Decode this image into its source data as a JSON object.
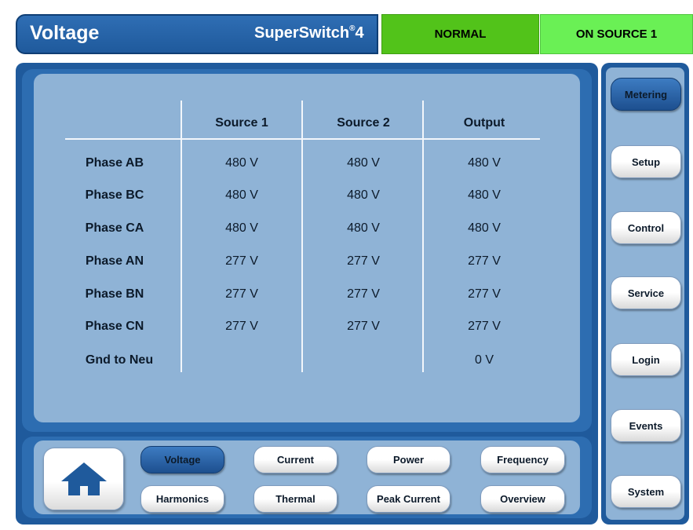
{
  "header": {
    "title": "Voltage",
    "product": "SuperSwitch",
    "product_sup": "®",
    "product_version": "4",
    "status_mode": "NORMAL",
    "status_source": "ON SOURCE 1"
  },
  "table": {
    "columns": [
      "Source 1",
      "Source 2",
      "Output"
    ],
    "rows": [
      {
        "label": "Phase AB",
        "values": [
          "480 V",
          "480 V",
          "480 V"
        ]
      },
      {
        "label": "Phase BC",
        "values": [
          "480 V",
          "480 V",
          "480 V"
        ]
      },
      {
        "label": "Phase CA",
        "values": [
          "480 V",
          "480 V",
          "480 V"
        ]
      },
      {
        "label": "Phase AN",
        "values": [
          "277 V",
          "277 V",
          "277 V"
        ]
      },
      {
        "label": "Phase BN",
        "values": [
          "277 V",
          "277 V",
          "277 V"
        ]
      },
      {
        "label": "Phase CN",
        "values": [
          "277 V",
          "277 V",
          "277 V"
        ]
      },
      {
        "label": "Gnd to Neu",
        "values": [
          "",
          "",
          "0 V"
        ]
      }
    ]
  },
  "bottom_nav": {
    "home_icon": "home-icon",
    "items": [
      "Voltage",
      "Current",
      "Power",
      "Frequency",
      "Harmonics",
      "Thermal",
      "Peak Current",
      "Overview"
    ],
    "active": "Voltage"
  },
  "side_nav": {
    "items": [
      "Metering",
      "Setup",
      "Control",
      "Service",
      "Login",
      "Events",
      "System"
    ],
    "active": "Metering"
  },
  "colors": {
    "header_blue": "#2f6eb4",
    "status_normal": "#52c31a",
    "status_source": "#6af055",
    "panel_light": "#8fb3d6"
  }
}
